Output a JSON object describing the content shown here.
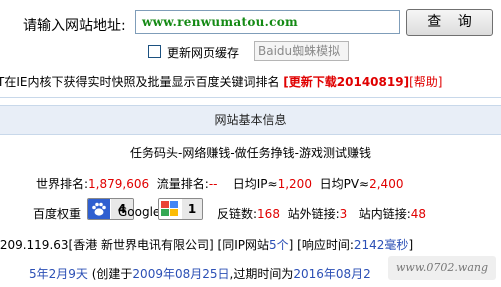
{
  "form": {
    "url_label": "请输入网站地址:",
    "url_value": "www.renwumatou.com",
    "query_button": "查 询",
    "refresh_cache_label": "更新网页缓存",
    "engine_value": "Baidu蜘蛛模拟"
  },
  "notice": {
    "text": "T在IE内核下获得实时快照及批量显示百度关键词排名",
    "download_link": "[更新下载20140819]",
    "help_link": "[帮助]"
  },
  "section": {
    "header": "网站基本信息"
  },
  "site": {
    "title": "任务码头-网络赚钱-做任务挣钱-游戏测试赚钱",
    "world_rank_label": "世界排名:",
    "world_rank_value": "1,879,606",
    "traffic_rank_label": "流量排名:",
    "traffic_rank_value": "--",
    "daily_ip_label": "日均IP≈",
    "daily_ip_value": "1,200",
    "daily_pv_label": "日均PV≈",
    "daily_pv_value": "2,400"
  },
  "weights": {
    "baidu_label": "百度权重",
    "baidu_value": "4",
    "google_label": "Google",
    "google_value": "1",
    "backlinks_label": "反链数:",
    "backlinks_value": "168",
    "outbound_label": "站外链接:",
    "outbound_value": "3",
    "inbound_label": "站内链接:",
    "inbound_value": "48"
  },
  "server": {
    "ip_text": ".209.119.63[香港 新世界电讯有限公司]",
    "same_ip_prefix": "[同IP网站",
    "same_ip_value": "5个",
    "same_ip_suffix": "]",
    "response_label": "[响应时间:",
    "response_value": "2142毫秒",
    "response_suffix": "]"
  },
  "domain": {
    "age": "5年2月9天",
    "created_prefix": "(创建于",
    "created_date": "2009年08月25日",
    "expire_prefix": ",过期时间为",
    "expire_date": "2016年08月2"
  },
  "watermark": {
    "text": "www.0702.wang"
  },
  "colors": {
    "green_url": "#148a14",
    "red_value": "#e00000",
    "blue_link": "#2b4fb5",
    "section_bg": "#e8eef7"
  }
}
